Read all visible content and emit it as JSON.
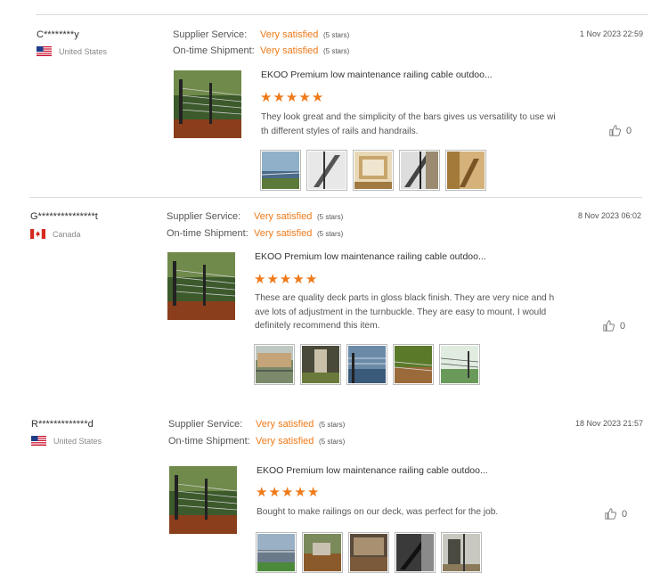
{
  "reviews": [
    {
      "user": "C********y",
      "country": "United States",
      "flag": "us",
      "supplier_label": "Supplier Service:",
      "supplier_value": "Very satisfied",
      "supplier_note": "(5 stars)",
      "shipment_label": "On-time Shipment:",
      "shipment_value": "Very satisfied",
      "shipment_note": "(5 stars)",
      "date": "1 Nov 2023 22:59",
      "product_title": "EKOO Premium low maintenance railing cable outdoo...",
      "rating": 5,
      "text_lines": [
        "They look great and the simplicity of the bars gives us versatility to use wi",
        "th different styles of rails and handrails."
      ],
      "likes": "0"
    },
    {
      "user": "G***************t",
      "country": "Canada",
      "flag": "ca",
      "supplier_label": "Supplier Service:",
      "supplier_value": "Very satisfied",
      "supplier_note": "(5 stars)",
      "shipment_label": "On-time Shipment:",
      "shipment_value": "Very satisfied",
      "shipment_note": "(5 stars)",
      "date": "8 Nov 2023 06:02",
      "product_title": "EKOO Premium low maintenance railing cable outdoo...",
      "rating": 5,
      "text_lines": [
        "These are quality deck parts in gloss black finish. They are very nice and h",
        "ave lots of adjustment in the turnbuckle. They are easy to mount.  I would",
        "definitely recommend this item."
      ],
      "likes": "0"
    },
    {
      "user": "R*************d",
      "country": "United States",
      "flag": "us",
      "supplier_label": "Supplier Service:",
      "supplier_value": "Very satisfied",
      "supplier_note": "(5 stars)",
      "shipment_label": "On-time Shipment:",
      "shipment_value": "Very satisfied",
      "shipment_note": "(5 stars)",
      "date": "18 Nov 2023 21:57",
      "product_title": "EKOO Premium low maintenance railing cable outdoo...",
      "rating": 5,
      "text_lines": [
        "Bought to make railings on our deck, was perfect for the job."
      ],
      "likes": "0"
    }
  ],
  "icons": {
    "thumbs_up": "thumbs-up-icon",
    "star": "star-icon"
  },
  "colors": {
    "accent": "#ee7a1a",
    "separator": "#dcdcdc"
  }
}
